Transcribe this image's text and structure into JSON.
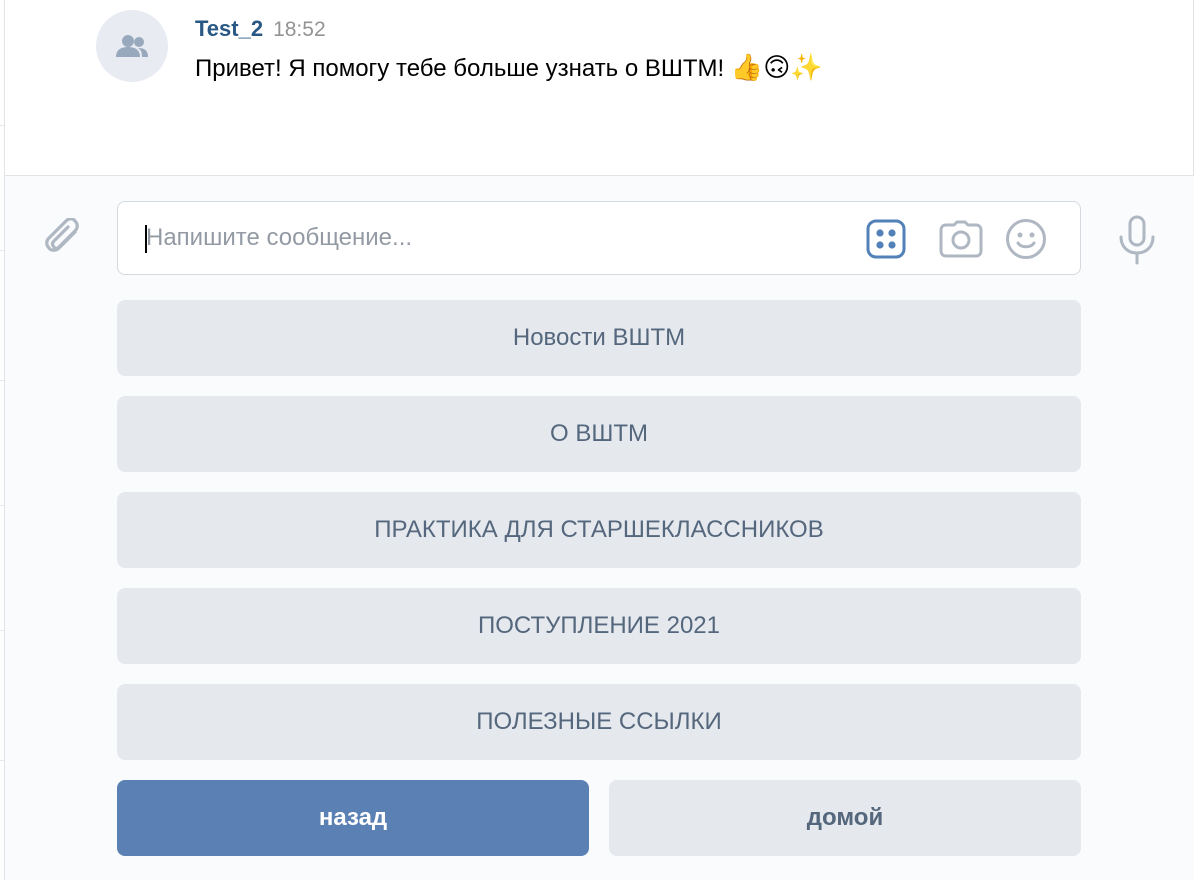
{
  "message": {
    "author": "Test_2",
    "time": "18:52",
    "text": "Привет! Я помогу тебе больше узнать о ВШТМ!",
    "emojis": "👍🙃✨",
    "avatar_icon": "group-avatar-icon"
  },
  "composer": {
    "placeholder": "Напишите сообщение...",
    "attach_icon": "paperclip-icon",
    "keyboard_icon": "bot-keyboard-icon",
    "camera_icon": "camera-icon",
    "emoji_icon": "smile-icon",
    "mic_icon": "microphone-icon"
  },
  "keyboard": {
    "buttons": [
      {
        "label": "Новости ВШТМ"
      },
      {
        "label": "О ВШТМ"
      },
      {
        "label": "ПРАКТИКА ДЛЯ СТАРШЕКЛАССНИКОВ"
      },
      {
        "label": "ПОСТУПЛЕНИЕ 2021"
      },
      {
        "label": "ПОЛЕЗНЫЕ ССЫЛКИ"
      }
    ],
    "back_label": "назад",
    "home_label": "домой"
  },
  "colors": {
    "author": "#2a5885",
    "primary_button": "#5b80b4",
    "secondary_button": "#e5e9ee",
    "secondary_text": "#55677d",
    "icon": "#aeb7c2",
    "active_icon": "#5181b8"
  }
}
